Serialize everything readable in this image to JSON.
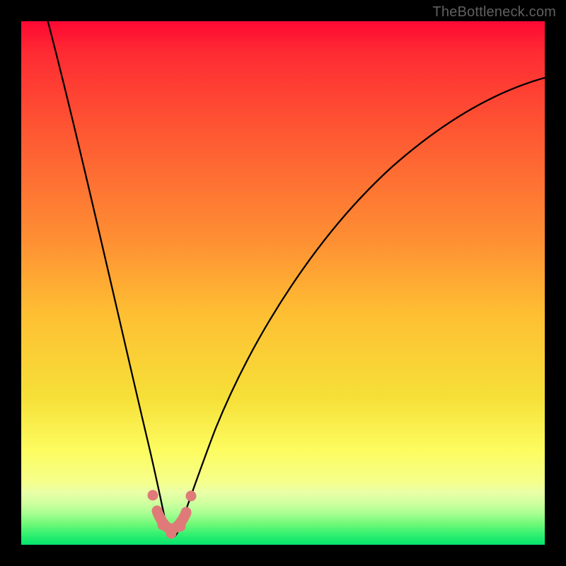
{
  "watermark": {
    "text": "TheBottleneck.com"
  },
  "plot": {
    "gradient_colors": {
      "top": "#fe0833",
      "upper_mid": "#fe9033",
      "mid": "#febf33",
      "lower_mid": "#fdfc60",
      "bottom": "#04e36c"
    },
    "curve_stroke": "#000000",
    "marker_color": "#df7a78"
  },
  "chart_data": {
    "type": "line",
    "title": "",
    "xlabel": "",
    "ylabel": "",
    "x": [
      0,
      2,
      4,
      6,
      8,
      10,
      12,
      14,
      16,
      18,
      20,
      22,
      24,
      25,
      26,
      27,
      28,
      29,
      30,
      31,
      32,
      34,
      36,
      40,
      45,
      50,
      55,
      60,
      65,
      70,
      75,
      80,
      85,
      90,
      95,
      100
    ],
    "values": [
      100,
      94,
      88,
      82,
      76,
      70,
      64,
      58,
      51,
      44,
      36,
      27,
      17,
      11,
      6,
      3,
      1,
      0.5,
      1,
      3,
      7,
      15,
      23,
      36,
      48,
      57,
      64,
      69,
      73,
      76,
      78.5,
      80.5,
      82,
      83,
      84,
      85
    ],
    "xlim": [
      0,
      100
    ],
    "ylim": [
      0,
      100
    ],
    "minimum_region": {
      "x_range": [
        25,
        32
      ],
      "y_range": [
        0,
        12
      ],
      "description": "dotted pink U-shaped marker cluster near curve minimum"
    },
    "annotations": [
      "TheBottleneck.com"
    ]
  }
}
